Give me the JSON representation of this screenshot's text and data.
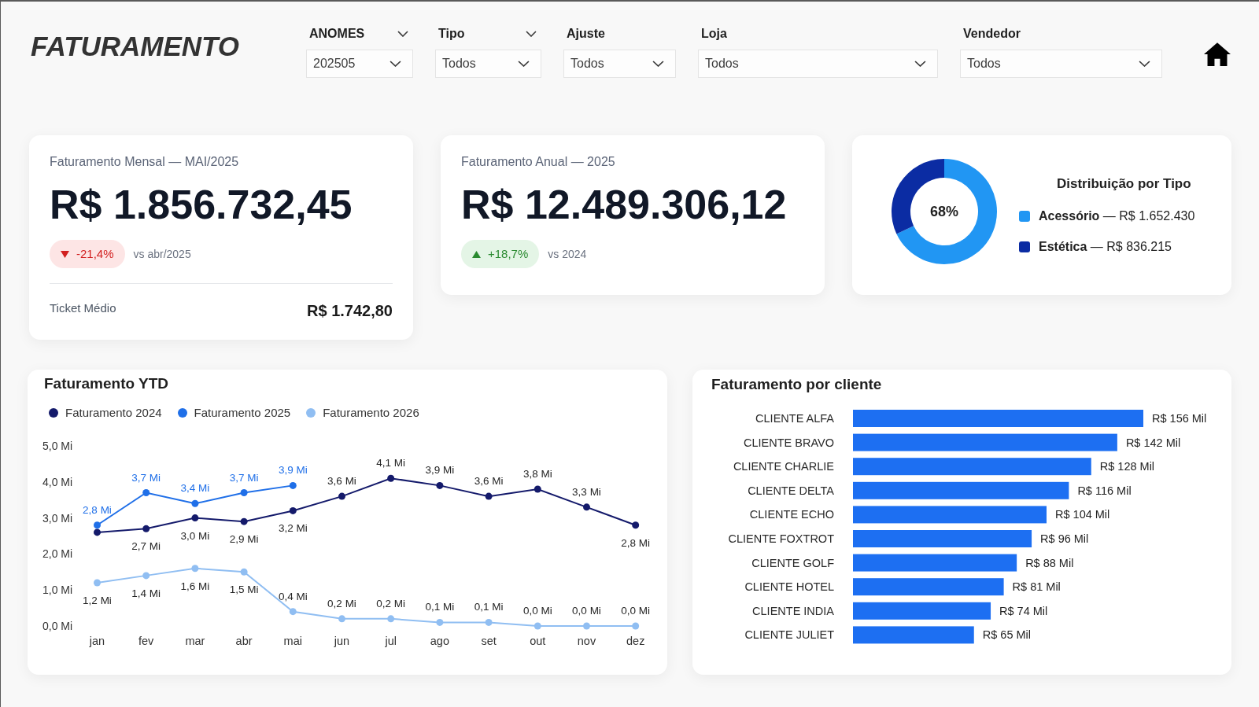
{
  "header": {
    "title": "FATURAMENTO"
  },
  "filters": [
    {
      "label": "ANOMES",
      "value": "202505",
      "header_chevron": true
    },
    {
      "label": "Tipo",
      "value": "Todos",
      "header_chevron": true
    },
    {
      "label": "Ajuste",
      "value": "Todos",
      "header_chevron": false
    },
    {
      "label": "Loja",
      "value": "Todos",
      "header_chevron": false
    },
    {
      "label": "Vendedor",
      "value": "Todos",
      "header_chevron": false
    }
  ],
  "kpi_cards": [
    {
      "title": "Faturamento Mensal — MAI/2025",
      "value": "R$ 1.856.732,45",
      "change": {
        "kind": "down",
        "text": "-21,4%",
        "comparison": "vs abr/2025"
      },
      "footer": {
        "label": "Ticket Médio",
        "value": "R$ 1.742,80"
      }
    },
    {
      "title": "Faturamento Anual — 2025",
      "value": "R$ 12.489.306,12",
      "change": {
        "kind": "up",
        "text": "+18,7%",
        "comparison": "vs 2024"
      }
    }
  ],
  "type_distribution": {
    "center_label": "68%",
    "chart_data": {
      "type": "donut",
      "title": "Distribuição por Tipo",
      "values": [
        68,
        32
      ]
    },
    "legend": [
      {
        "label": "**Acessório** — R$ 1.652.430",
        "color": "#2196f3"
      },
      {
        "label": "**Estética** — R$ 836.215",
        "color": "#0b2ca3"
      }
    ]
  },
  "ytd_chart": {
    "chart_data": {
      "type": "line",
      "title": "Faturamento YTD",
      "categories": [
        "jan",
        "fev",
        "mar",
        "abr",
        "mai",
        "jun",
        "jul",
        "ago",
        "set",
        "out",
        "nov",
        "dez"
      ],
      "series": [
        {
          "name": "Faturamento 2024",
          "color": "#141a6b",
          "marker": "circle",
          "values": [
            2.6,
            2.7,
            3.0,
            2.9,
            3.2,
            3.6,
            4.1,
            3.9,
            3.6,
            3.8,
            3.3,
            2.8
          ],
          "value_labels": [
            null,
            "2,7 Mi",
            "3,0 Mi",
            "2,9 Mi",
            "3,2 Mi",
            "3,6 Mi",
            "4,1 Mi",
            "3,9 Mi",
            "3,6 Mi",
            "3,8 Mi",
            "3,3 Mi",
            "2,8 Mi"
          ]
        },
        {
          "name": "Faturamento 2025",
          "color": "#1f6fe8",
          "marker": "circle",
          "values": [
            2.8,
            3.7,
            3.4,
            3.7,
            3.9,
            null,
            null,
            null,
            null,
            null,
            null,
            null
          ],
          "value_labels": [
            "2,8 Mi",
            "3,7 Mi",
            "3,4 Mi",
            "3,7 Mi",
            "3,9 Mi",
            null,
            null,
            null,
            null,
            null,
            null,
            null
          ]
        },
        {
          "name": "Faturamento 2026",
          "color": "#90bef2",
          "marker": "circle",
          "values": [
            1.2,
            1.4,
            1.6,
            1.5,
            0.4,
            0.2,
            0.2,
            0.1,
            0.1,
            0.0,
            0.0,
            0.0
          ],
          "value_labels": [
            "1,2 Mi",
            "1,4 Mi",
            "1,6 Mi",
            "1,5 Mi",
            "0,4 Mi",
            "0,2 Mi",
            "0,2 Mi",
            "0,1 Mi",
            "0,1 Mi",
            "0,0 Mi",
            "0,0 Mi",
            "0,0 Mi"
          ]
        }
      ],
      "ylim": [
        0,
        5
      ],
      "yticks": [
        {
          "value": 5,
          "label": "5,0 Mi"
        },
        {
          "value": 4,
          "label": "4,0 Mi"
        },
        {
          "value": 3,
          "label": "3,0 Mi"
        },
        {
          "value": 2,
          "label": "2,0 Mi"
        },
        {
          "value": 1,
          "label": "1,0 Mi"
        },
        {
          "value": 0,
          "label": "0,0 Mi"
        }
      ]
    }
  },
  "client_chart": {
    "chart_data": {
      "type": "bar",
      "orientation": "horizontal",
      "title": "Faturamento por cliente",
      "categories": [
        "CLIENTE ALFA",
        "CLIENTE BRAVO",
        "CLIENTE CHARLIE",
        "CLIENTE DELTA",
        "CLIENTE ECHO",
        "CLIENTE FOXTROT",
        "CLIENTE GOLF",
        "CLIENTE HOTEL",
        "CLIENTE INDIA",
        "CLIENTE JULIET"
      ],
      "values": [
        156,
        142,
        128,
        116,
        104,
        96,
        88,
        81,
        74,
        65
      ],
      "value_labels": [
        "R$ 156 Mil",
        "R$ 142 Mil",
        "R$ 128 Mil",
        "R$ 116 Mil",
        "R$ 104 Mil",
        "R$ 96 Mil",
        "R$ 88 Mil",
        "R$ 81 Mil",
        "R$ 74 Mil",
        "R$ 65 Mil"
      ]
    }
  }
}
